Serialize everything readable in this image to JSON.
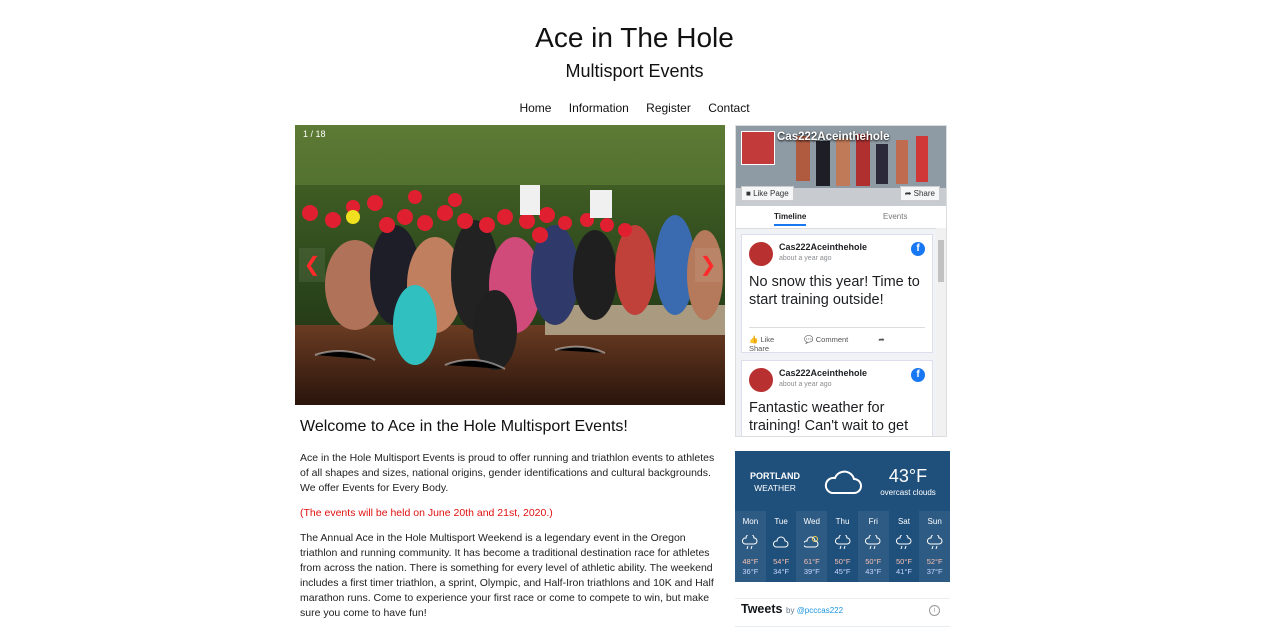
{
  "header": {
    "title": "Ace in The Hole",
    "subtitle": "Multisport Events"
  },
  "nav": {
    "items": [
      "Home",
      "Information",
      "Register",
      "Contact"
    ]
  },
  "slideshow": {
    "counter": "1 / 18",
    "prev_icon": "chevron-left-icon",
    "next_icon": "chevron-right-icon",
    "prev_glyph": "❮",
    "next_glyph": "❯"
  },
  "main": {
    "heading": "Welcome to Ace in the Hole Multisport Events!",
    "paragraph1": "Ace in the Hole Multisport Events is proud to offer running and triathlon events to athletes of all shapes and sizes, national origins, gender identifications and cultural backgrounds. We offer Events for Every Body.",
    "notice": "(The events will be held on June 20th and 21st, 2020.)",
    "notice_color": "#e01010",
    "paragraph2": "The Annual Ace in the Hole Multisport Weekend is a legendary event in the Oregon triathlon and running community. It has become a traditional destination race for athletes from across the nation. There is something for every level of athletic ability. The weekend includes a first timer triathlon, a sprint, Olympic, and Half-Iron triathlons and 10K and Half marathon runs. Come to experience your first race or come to compete to win, but make sure you come to have fun!"
  },
  "facebook": {
    "page_name": "Cas222Aceinthehole",
    "like_label": "Like Page",
    "share_label": "Share",
    "tabs": [
      "Timeline",
      "Events"
    ],
    "posts": [
      {
        "author": "Cas222Aceinthehole",
        "time": "about a year ago",
        "text": "No snow this year! Time to start training outside!",
        "actions": [
          "Like",
          "Comment",
          "Share"
        ]
      },
      {
        "author": "Cas222Aceinthehole",
        "time": "about a year ago",
        "text": "Fantastic weather for training! Can't wait to get"
      }
    ],
    "brand_color": "#1877f2"
  },
  "weather": {
    "city": "PORTLAND",
    "label": "WEATHER",
    "temp": "43°F",
    "description": "overcast clouds",
    "icon": "cloud-icon",
    "days": [
      {
        "name": "Mon",
        "hi": "48°F",
        "lo": "36°F",
        "icon": "rain-cloud-icon"
      },
      {
        "name": "Tue",
        "hi": "54°F",
        "lo": "34°F",
        "icon": "cloud-icon"
      },
      {
        "name": "Wed",
        "hi": "61°F",
        "lo": "39°F",
        "icon": "partly-cloudy-icon"
      },
      {
        "name": "Thu",
        "hi": "50°F",
        "lo": "45°F",
        "icon": "rain-cloud-icon"
      },
      {
        "name": "Fri",
        "hi": "50°F",
        "lo": "43°F",
        "icon": "rain-cloud-icon"
      },
      {
        "name": "Sat",
        "hi": "50°F",
        "lo": "41°F",
        "icon": "rain-cloud-icon"
      },
      {
        "name": "Sun",
        "hi": "52°F",
        "lo": "37°F",
        "icon": "rain-cloud-icon"
      }
    ],
    "bg_color": "#1f4f7b"
  },
  "tweets": {
    "title": "Tweets",
    "by": "by",
    "handle": "@pcccas222",
    "info_glyph": "i"
  }
}
